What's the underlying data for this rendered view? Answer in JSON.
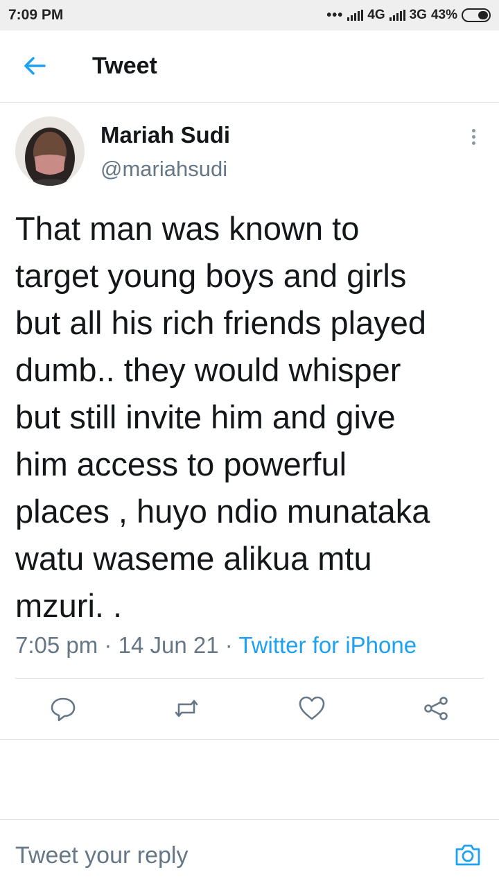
{
  "status_bar": {
    "time": "7:09 PM",
    "dots": "•••",
    "network1": "4G",
    "network2": "3G",
    "battery": "43%"
  },
  "header": {
    "title": "Tweet",
    "back_icon": "arrow-left-icon"
  },
  "tweet": {
    "author_name": "Mariah Sudi",
    "author_handle": "@mariahsudi",
    "text": "That man was known to\ntarget young boys and girls\nbut all his rich friends played\ndumb.. they would whisper\nbut still invite him and give\nhim access to powerful\nplaces , huyo ndio munataka\nwatu waseme alikua mtu\nmzuri. .",
    "time": "7:05 pm",
    "separator": "·",
    "date": "14 Jun 21",
    "source": "Twitter for iPhone"
  },
  "actions": [
    {
      "name": "reply",
      "icon": "comment-icon"
    },
    {
      "name": "retweet",
      "icon": "retweet-icon"
    },
    {
      "name": "like",
      "icon": "heart-icon"
    },
    {
      "name": "share",
      "icon": "share-icon"
    }
  ],
  "reply_bar": {
    "placeholder": "Tweet your reply",
    "camera_icon": "camera-icon"
  },
  "colors": {
    "accent": "#1da1f2",
    "secondary_text": "#657786",
    "primary_text": "#14171a",
    "divider": "#dcdfe2"
  }
}
